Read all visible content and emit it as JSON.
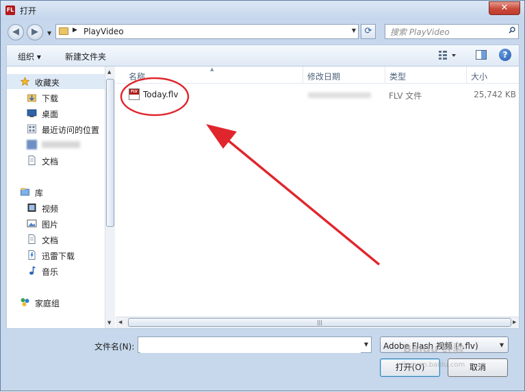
{
  "window": {
    "title": "打开",
    "app_badge": "FL",
    "close_glyph": "✕"
  },
  "nav": {
    "back_glyph": "◀",
    "forward_glyph": "▶",
    "address_path": "PlayVideo",
    "search_placeholder": "搜索 PlayVideo"
  },
  "toolbar": {
    "organize_label": "组织 ▾",
    "new_folder_label": "新建文件夹",
    "help_glyph": "?"
  },
  "sidebar": {
    "favorites": {
      "label": "收藏夹",
      "icon": "star-icon"
    },
    "favorite_items": [
      {
        "label": "下载",
        "icon": "download-folder-icon"
      },
      {
        "label": "桌面",
        "icon": "desktop-icon"
      },
      {
        "label": "最近访问的位置",
        "icon": "recent-places-icon"
      },
      {
        "label": "",
        "icon": "blurred-item-icon"
      },
      {
        "label": "文档",
        "icon": "document-icon"
      }
    ],
    "libraries": {
      "label": "库",
      "icon": "library-icon"
    },
    "library_items": [
      {
        "label": "视频",
        "icon": "video-icon"
      },
      {
        "label": "图片",
        "icon": "picture-icon"
      },
      {
        "label": "文档",
        "icon": "document-icon"
      },
      {
        "label": "迅雷下载",
        "icon": "thunder-download-icon"
      },
      {
        "label": "音乐",
        "icon": "music-icon"
      }
    ],
    "homegroup": {
      "label": "家庭组",
      "icon": "homegroup-icon"
    }
  },
  "columns": [
    "名称",
    "修改日期",
    "类型",
    "大小"
  ],
  "files": [
    {
      "name": "Today.flv",
      "modified": "",
      "type": "FLV 文件",
      "size": "25,742 KB",
      "icon_badge": "FLV"
    }
  ],
  "bottom": {
    "filename_label": "文件名(N):",
    "filename_value": "",
    "filetype_value": "Adobe Flash 视频 (*.flv)",
    "open_label": "打开(O)",
    "cancel_label": "取消"
  },
  "watermark": {
    "text": "Baidu 经验",
    "url": "jingyan.baidu.com"
  },
  "colors": {
    "annotation_red": "#e0262c",
    "frame": "#c7d8ec",
    "selection": "#dfeaf7"
  }
}
